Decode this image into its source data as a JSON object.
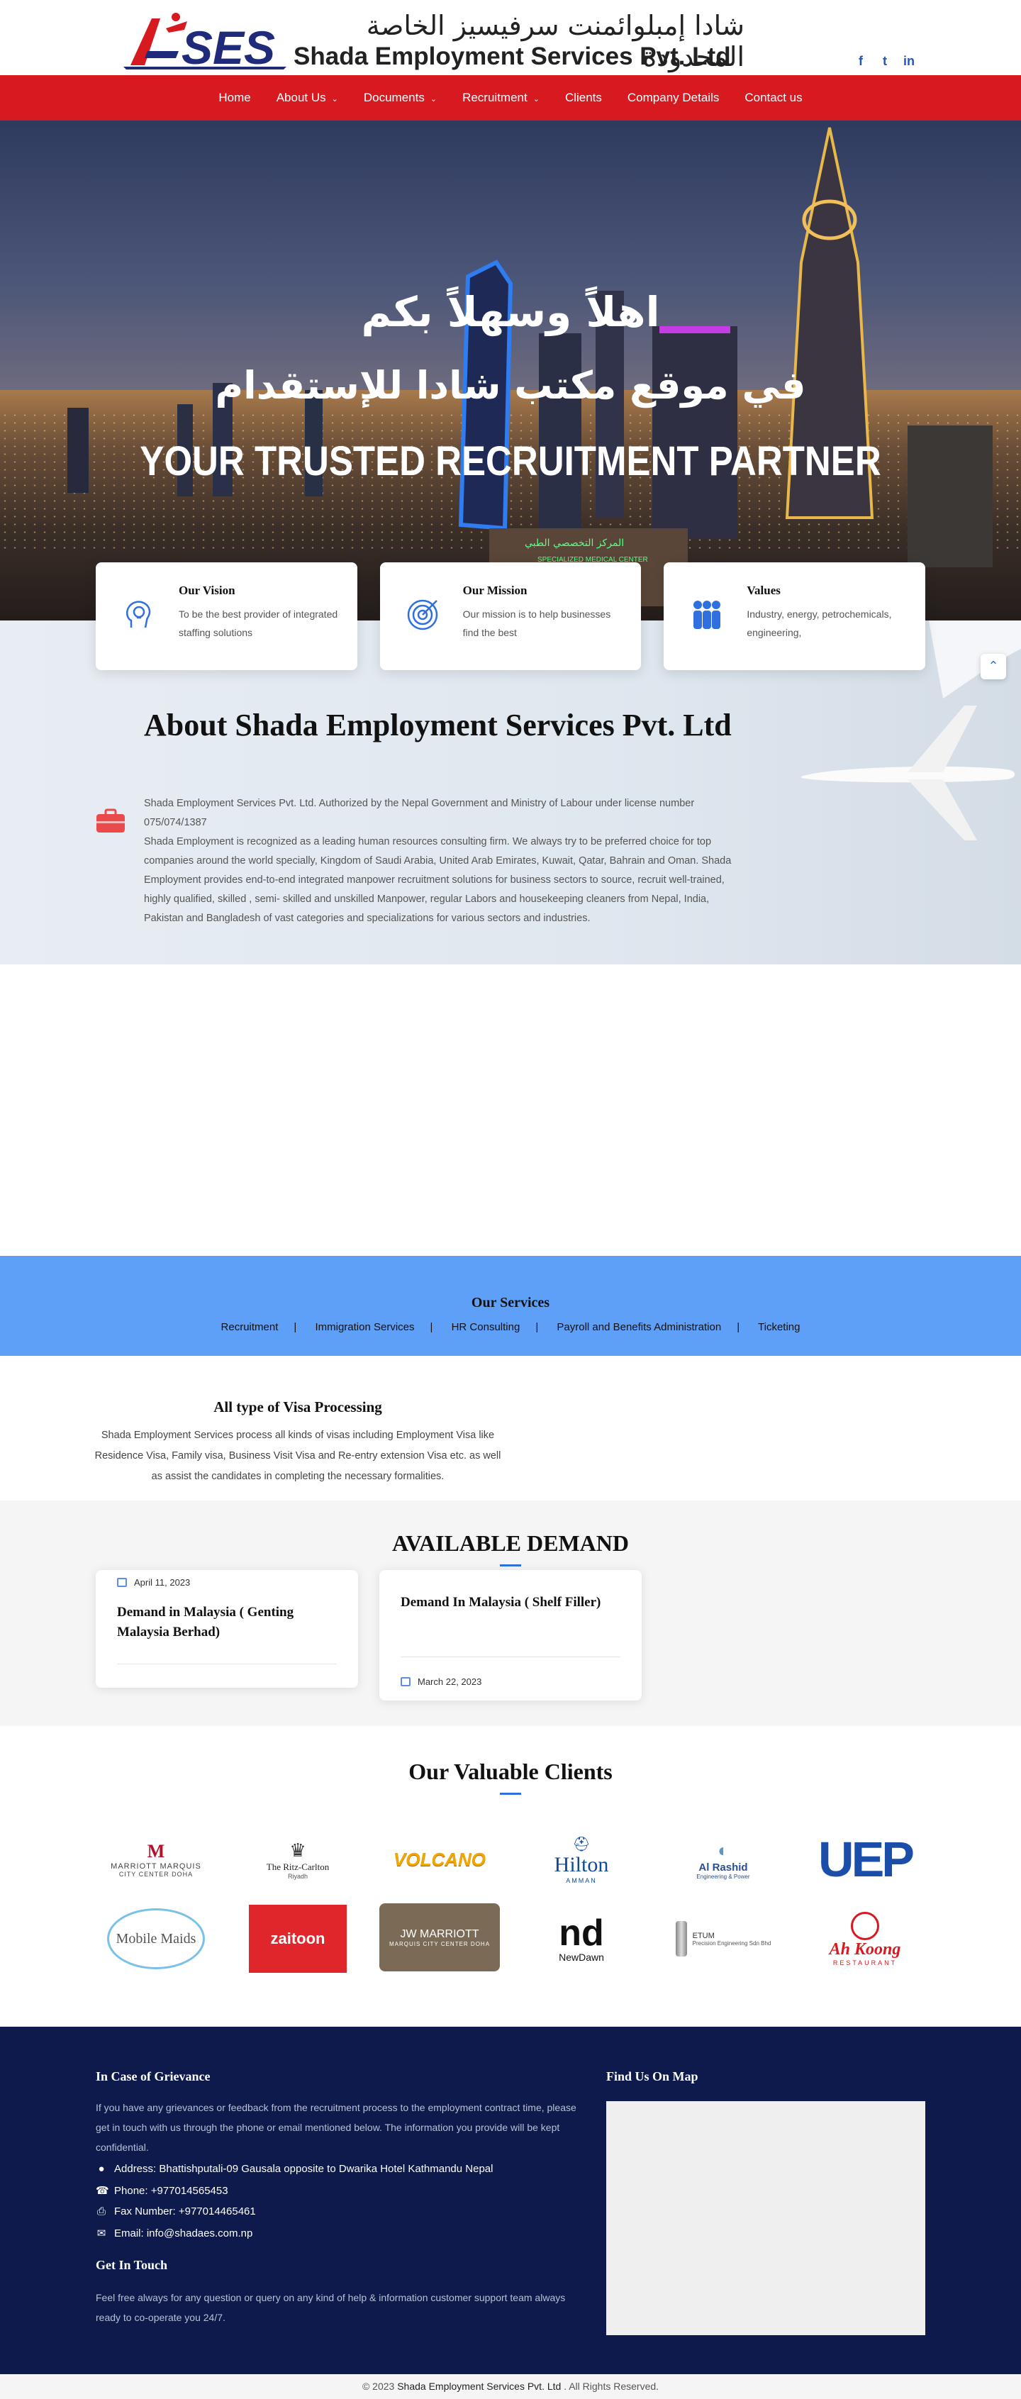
{
  "header": {
    "logo_text": "SES",
    "title_arabic": "شادا إمبلوائمنت سرفيسيز الخاصة المحدودة",
    "title_english": "Shada Employment Services Pvt. Ltd",
    "social": [
      "f",
      "t",
      "in"
    ]
  },
  "nav": {
    "items": [
      {
        "label": "Home",
        "dropdown": false
      },
      {
        "label": "About Us",
        "dropdown": true
      },
      {
        "label": "Documents",
        "dropdown": true
      },
      {
        "label": "Recruitment",
        "dropdown": true
      },
      {
        "label": "Clients",
        "dropdown": false
      },
      {
        "label": "Company Details",
        "dropdown": false
      },
      {
        "label": "Contact us",
        "dropdown": false
      }
    ]
  },
  "hero": {
    "line1": "اهلاً وسهلاً بكم",
    "line2": "في موقع مكتب شادا للإستقدام",
    "line3": "YOUR TRUSTED RECRUITMENT PARTNER",
    "sign": "المركز التخصصي الطبي",
    "sign_en": "SPECIALIZED MEDICAL CENTER"
  },
  "cards": [
    {
      "title": "Our Vision",
      "text": "To be the best provider of integrated staffing solutions",
      "icon": "lightbulb-head-icon"
    },
    {
      "title": "Our Mission",
      "text": "Our mission is to help businesses find the best",
      "icon": "target-icon"
    },
    {
      "title": "Values",
      "text": "Industry, energy, petrochemicals, engineering,",
      "icon": "people-group-icon"
    }
  ],
  "about": {
    "title": "About Shada Employment Services Pvt. Ltd",
    "p1": "Shada Employment Services Pvt. Ltd. Authorized by the Nepal Government and Ministry of Labour under license number 075/074/1387",
    "p2": "Shada Employment is recognized as a leading human resources consulting firm. We always try to be preferred choice for top companies around the world specially, Kingdom of Saudi Arabia, United Arab Emirates, Kuwait, Qatar, Bahrain and Oman. Shada Employment provides end-to-end integrated manpower recruitment solutions for business sectors to source, recruit well-trained, highly qualified, skilled , semi- skilled and unskilled Manpower, regular Labors and housekeeping cleaners from Nepal, India, Pakistan and Bangladesh of vast categories and specializations for various sectors and industries."
  },
  "services": {
    "title": "Our Services",
    "items": [
      "Recruitment",
      "Immigration Services",
      "HR Consulting",
      "Payroll and Benefits Administration",
      "Ticketing"
    ]
  },
  "visa": {
    "title": "All type of Visa Processing",
    "text": "Shada Employment Services process all kinds of visas including Employment Visa like Residence Visa, Family visa, Business Visit Visa and Re-entry extension Visa etc. as well as assist the candidates in completing the necessary formalities."
  },
  "demand": {
    "title": "AVAILABLE DEMAND",
    "items": [
      {
        "date": "April 11, 2023",
        "title": "Demand in Malaysia ( Genting Malaysia Berhad)"
      },
      {
        "date": "March 22, 2023",
        "title": "Demand In Malaysia ( Shelf Filler)"
      }
    ]
  },
  "clients": {
    "title": "Our Valuable Clients",
    "logos": [
      {
        "name": "MARRIOTT MARQUIS",
        "sub": "CITY CENTER DOHA"
      },
      {
        "name": "The Ritz-Carlton",
        "sub": "Riyadh"
      },
      {
        "name": "VOLCANO",
        "sub": ""
      },
      {
        "name": "Hilton",
        "sub": "AMMAN"
      },
      {
        "name": "Al Rashid",
        "sub": "Engineering & Power"
      },
      {
        "name": "UEP",
        "sub": ""
      },
      {
        "name": "Mobile Maids",
        "sub": ""
      },
      {
        "name": "zaitoon",
        "sub": ""
      },
      {
        "name": "JW MARRIOTT",
        "sub": "MARQUIS CITY CENTER DOHA"
      },
      {
        "name": "NewDawn",
        "sub": ""
      },
      {
        "name": "ETUM",
        "sub": "Precision Engineering Sdn Bhd"
      },
      {
        "name": "Ah Koong",
        "sub": "RESTAURANT"
      }
    ]
  },
  "footer": {
    "grievance_title": "In Case of Grievance",
    "grievance_text": "If you have any grievances or feedback from the recruitment process to the employment contract time, please get in touch with us through the phone or email mentioned below. The information you provide will be kept confidential.",
    "address": "Address: Bhattishputali-09 Gausala opposite to Dwarika Hotel Kathmandu Nepal",
    "phone": "Phone: +977014565453",
    "fax": "Fax Number: +977014465461",
    "email": "Email: info@shadaes.com.np",
    "touch_title": "Get In Touch",
    "touch_text": "Feel free always for any question or query on any kind of help & information customer support team always ready to co-operate you 24/7.",
    "map_title": "Find Us On Map"
  },
  "copyright": {
    "prefix": "© 2023",
    "company": "Shada Employment Services Pvt. Ltd",
    "suffix": ". All Rights Reserved."
  },
  "colors": {
    "nav": "#d71920",
    "services": "#5ea0f7",
    "footer": "#0d1a4b",
    "accent": "#2f6fe0"
  }
}
